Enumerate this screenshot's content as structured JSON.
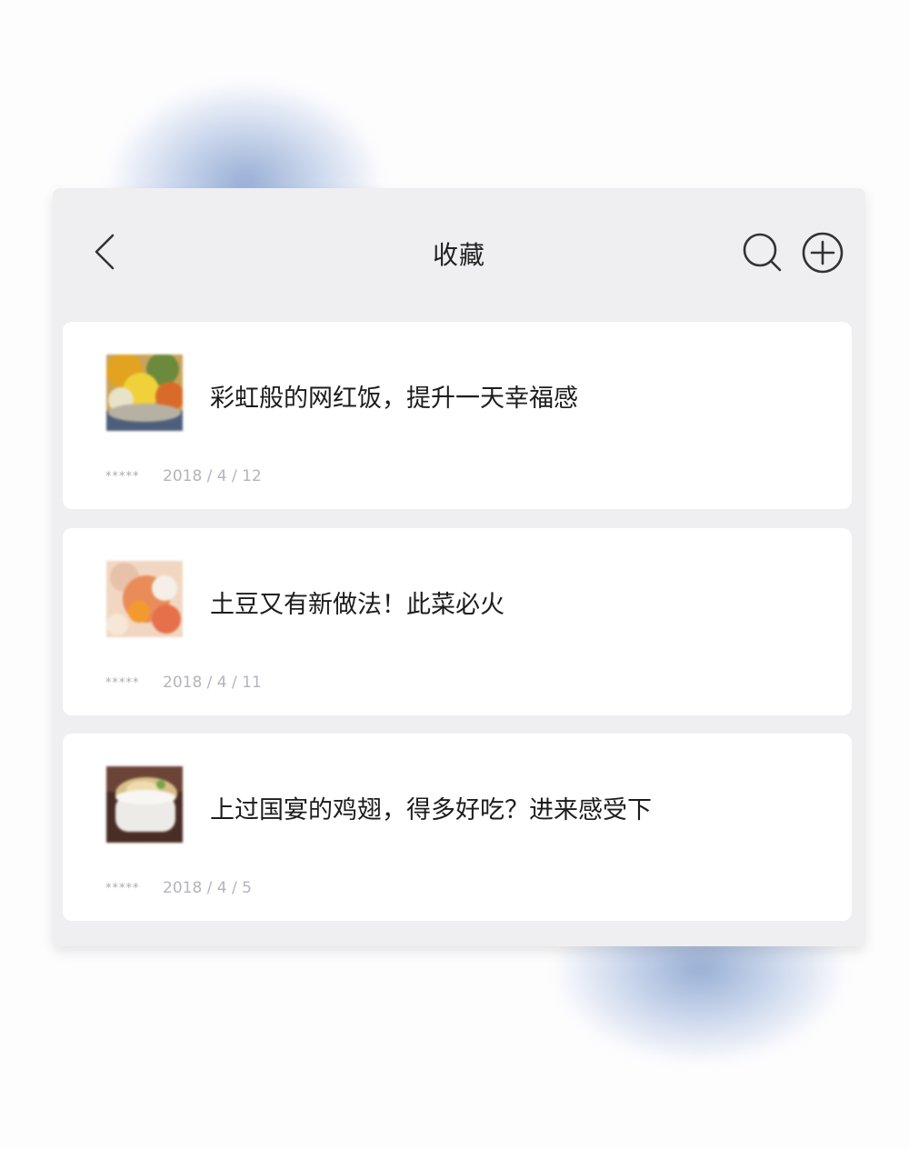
{
  "header": {
    "title": "收藏"
  },
  "items": [
    {
      "title": "彩虹般的网红饭，提升一天幸福感",
      "rating": "*****",
      "date": "2018 / 4 / 12"
    },
    {
      "title": "土豆又有新做法！此菜必火",
      "rating": "*****",
      "date": "2018 / 4 / 11"
    },
    {
      "title": "上过国宴的鸡翅，得多好吃？进来感受下",
      "rating": "*****",
      "date": "2018 / 4 / 5"
    }
  ],
  "colors": {
    "panel_bg": "#efeff1",
    "card_bg": "#ffffff",
    "glow": "#92aad2"
  }
}
